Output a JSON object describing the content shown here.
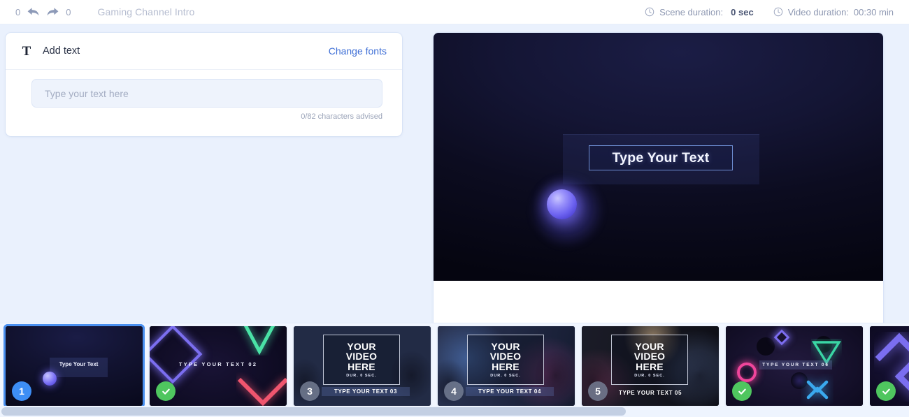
{
  "topbar": {
    "undo_count": "0",
    "redo_count": "0",
    "undo_icon": "undo-arrow-icon",
    "redo_icon": "redo-arrow-icon",
    "document_title": "Gaming Channel Intro",
    "scene_duration_label": "Scene duration:",
    "scene_duration_value": "0 sec",
    "video_duration_label": "Video duration:",
    "video_duration_value": "00:30 min",
    "clock_icon": "clock-icon"
  },
  "text_panel": {
    "icon": "text-t-icon",
    "title": "Add text",
    "change_fonts": "Change fonts",
    "input_value": "",
    "input_placeholder": "Type your text here",
    "char_counter": "0/82 characters advised"
  },
  "preview": {
    "overlay_text": "Type Your Text"
  },
  "thumbnails": [
    {
      "index": "1",
      "badge_type": "number",
      "badge_value": "1",
      "selected": true,
      "caption": "Type Your Text"
    },
    {
      "index": "2",
      "badge_type": "check",
      "badge_value": "",
      "selected": false,
      "caption": "TYPE YOUR TEXT 02"
    },
    {
      "index": "3",
      "badge_type": "number",
      "badge_value": "3",
      "selected": false,
      "video_line1": "YOUR",
      "video_line2": "VIDEO",
      "video_line3": "HERE",
      "video_duration": "DUR. 0 SEC.",
      "caption": "TYPE YOUR TEXT 03"
    },
    {
      "index": "4",
      "badge_type": "number",
      "badge_value": "4",
      "selected": false,
      "video_line1": "YOUR",
      "video_line2": "VIDEO",
      "video_line3": "HERE",
      "video_duration": "DUR. 0 SEC.",
      "caption": "TYPE YOUR TEXT 04"
    },
    {
      "index": "5",
      "badge_type": "number",
      "badge_value": "5",
      "selected": false,
      "video_line1": "YOUR",
      "video_line2": "VIDEO",
      "video_line3": "HERE",
      "video_duration": "DUR. 0 SEC.",
      "caption": "TYPE YOUR TEXT 05"
    },
    {
      "index": "6",
      "badge_type": "check",
      "badge_value": "",
      "selected": false,
      "caption": "TYPE YOUR TEXT 06"
    },
    {
      "index": "7",
      "badge_type": "check",
      "badge_value": "",
      "selected": false,
      "caption": ""
    }
  ],
  "colors": {
    "page_background": "#eaf1fd",
    "accent_link": "#3f6fd6",
    "selection_border": "#4a90f0",
    "badge_number": "#3d8ef5",
    "badge_check": "#4fc65f",
    "strip_background": "#f1f6ff",
    "scrollbar_thumb": "#c3cfe3"
  }
}
